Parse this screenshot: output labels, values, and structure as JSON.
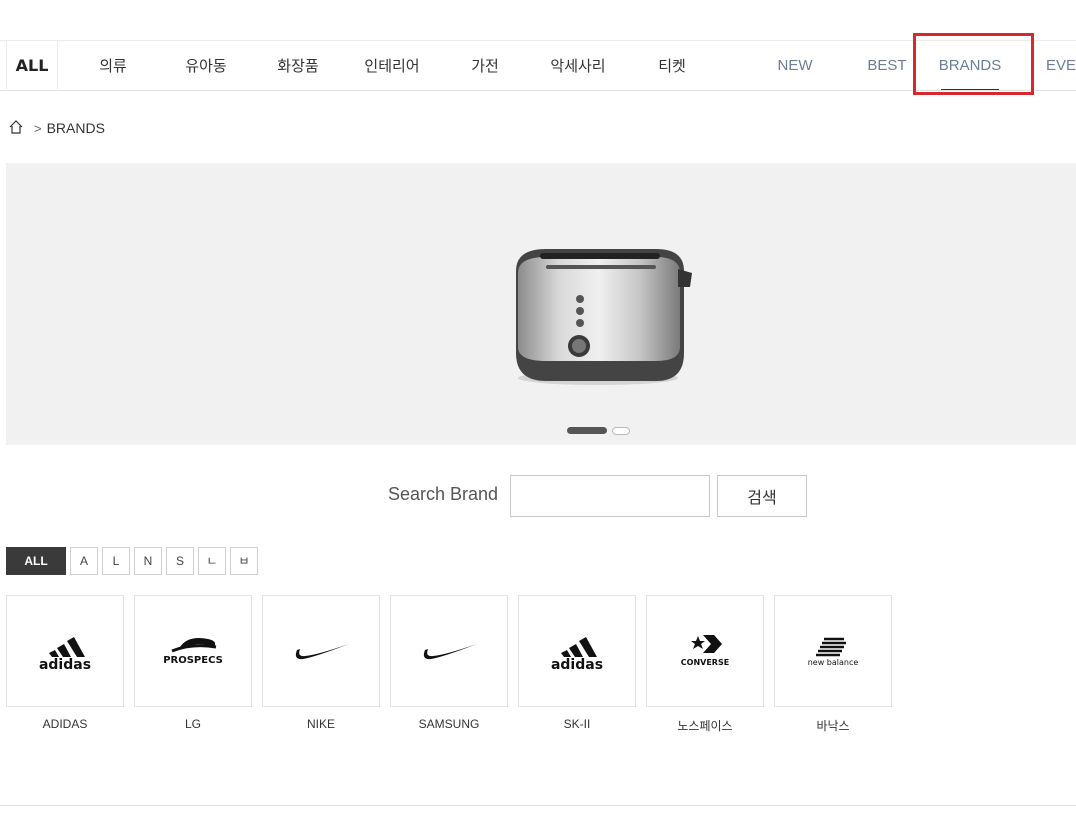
{
  "nav": {
    "all_label": "ALL",
    "categories": [
      "의류",
      "유아동",
      "화장품",
      "인테리어",
      "가전",
      "악세사리",
      "티켓"
    ],
    "specials": [
      "NEW",
      "BEST",
      "BRANDS",
      "EVEI"
    ]
  },
  "breadcrumb": {
    "home_icon": "home-icon",
    "separator": ">",
    "current": "BRANDS"
  },
  "banner": {
    "image": "toaster-image",
    "slide_index": 1,
    "slide_count": 2
  },
  "search": {
    "label": "Search Brand",
    "value": "",
    "placeholder": "",
    "button_label": "검색"
  },
  "filters": [
    "ALL",
    "A",
    "L",
    "N",
    "S",
    "ㄴ",
    "ㅂ"
  ],
  "brands": [
    {
      "name": "ADIDAS",
      "logo": "adidas-logo",
      "logo_text": "adidas"
    },
    {
      "name": "LG",
      "logo": "prospecs-logo",
      "logo_text": "PROSPECS"
    },
    {
      "name": "NIKE",
      "logo": "nike-swoosh-logo",
      "logo_text": ""
    },
    {
      "name": "SAMSUNG",
      "logo": "nike-swoosh-logo",
      "logo_text": ""
    },
    {
      "name": "SK-II",
      "logo": "adidas-logo",
      "logo_text": "adidas"
    },
    {
      "name": "노스페이스",
      "logo": "converse-logo",
      "logo_text": "CONVERSE"
    },
    {
      "name": "바낙스",
      "logo": "new-balance-logo",
      "logo_text": "new balance"
    }
  ],
  "colors": {
    "highlight": "#d9272f",
    "special_nav": "#6d7d98",
    "active_filter": "#3a3a3a"
  }
}
